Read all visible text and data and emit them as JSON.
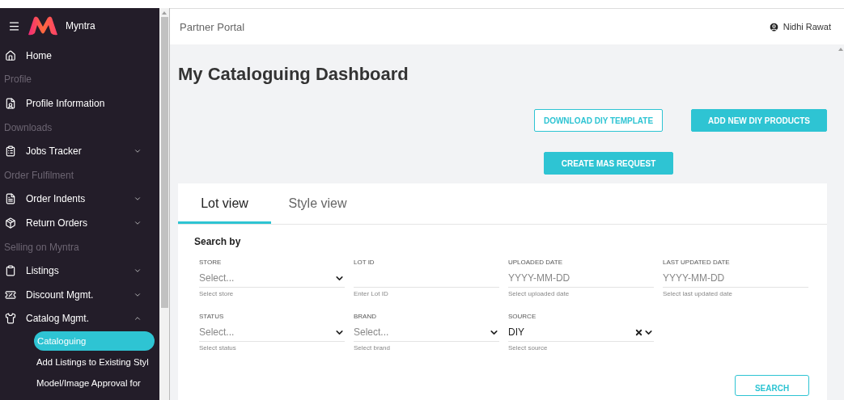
{
  "sidebar": {
    "brand": "Myntra",
    "items": [
      {
        "kind": "item",
        "label": "Home"
      },
      {
        "kind": "section",
        "label": "Profile"
      },
      {
        "kind": "item",
        "label": "Profile Information"
      },
      {
        "kind": "section",
        "label": "Downloads"
      },
      {
        "kind": "item",
        "label": "Jobs Tracker",
        "expanded": false
      },
      {
        "kind": "section",
        "label": "Order Fulfilment"
      },
      {
        "kind": "item",
        "label": "Order Indents",
        "expanded": false
      },
      {
        "kind": "item",
        "label": "Return Orders",
        "expanded": false
      },
      {
        "kind": "section",
        "label": "Selling on Myntra"
      },
      {
        "kind": "item",
        "label": "Listings",
        "expanded": false
      },
      {
        "kind": "item",
        "label": "Discount Mgmt.",
        "expanded": false
      },
      {
        "kind": "item",
        "label": "Catalog Mgmt.",
        "expanded": true,
        "children": [
          {
            "label": "Cataloguing",
            "selected": true
          },
          {
            "label": "Add Listings to Existing Styl",
            "selected": false
          },
          {
            "label": "Model/Image Approval for",
            "selected": false
          }
        ]
      }
    ]
  },
  "header": {
    "title": "Partner Portal",
    "user": "Nidhi Rawat"
  },
  "page": {
    "title": "My Cataloguing Dashboard",
    "actions": [
      {
        "label": "DOWNLOAD DIY TEMPLATE",
        "kind": "outline"
      },
      {
        "label": "ADD NEW DIY PRODUCTS",
        "kind": "filled"
      },
      {
        "label": "CREATE MAS REQUEST",
        "kind": "filled"
      }
    ],
    "tabs": [
      {
        "label": "Lot view",
        "selected": true
      },
      {
        "label": "Style view",
        "selected": false
      }
    ],
    "search_heading": "Search by",
    "fields": [
      {
        "kind": "select",
        "label": "STORE",
        "placeholder": "Select...",
        "hint": "Select store"
      },
      {
        "kind": "text",
        "label": "LOT ID",
        "hint": "Enter Lot ID"
      },
      {
        "kind": "date",
        "label": "UPLOADED DATE",
        "placeholder": "YYYY-MM-DD",
        "hint": "Select uploaded date"
      },
      {
        "kind": "date",
        "label": "LAST UPDATED DATE",
        "placeholder": "YYYY-MM-DD",
        "hint": "Select last updated date"
      },
      {
        "kind": "select",
        "label": "STATUS",
        "placeholder": "Select...",
        "hint": "Select status"
      },
      {
        "kind": "select",
        "label": "BRAND",
        "placeholder": "Select...",
        "hint": "Select brand"
      },
      {
        "kind": "select",
        "label": "SOURCE",
        "value": "DIY",
        "hint": "Select source"
      }
    ],
    "search_button": "SEARCH"
  }
}
